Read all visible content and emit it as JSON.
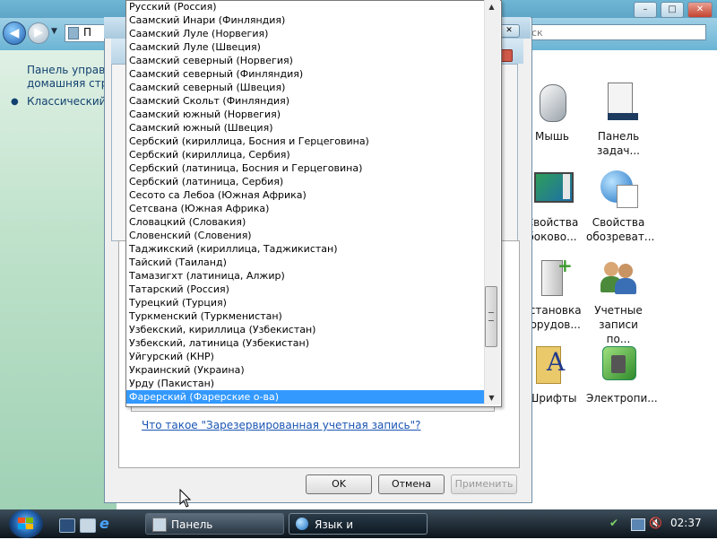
{
  "control_panel": {
    "sidebar": {
      "home_line1": "Панель управле",
      "home_line2": "домашняя стра",
      "classic_view": "Классический в"
    },
    "search_placeholder": "ск",
    "address_char": "П",
    "icons": [
      {
        "line1": "Мышь",
        "line2": ""
      },
      {
        "line1": "Панель",
        "line2": "задач..."
      },
      {
        "line1": "Свойства",
        "line2": "боково..."
      },
      {
        "line1": "Свойства",
        "line2": "обозреват..."
      },
      {
        "line1": "Установка",
        "line2": "борудов..."
      },
      {
        "line1": "Учетные",
        "line2": "записи по..."
      },
      {
        "line1": "Шрифты",
        "line2": ""
      },
      {
        "line1": "Электропи...",
        "line2": ""
      }
    ]
  },
  "dialog": {
    "link": "Что такое \"Зарезервированная учетная запись\"?",
    "buttons": {
      "ok": "OK",
      "cancel": "Отмена",
      "apply": "Применить"
    }
  },
  "language_list": {
    "items": [
      "Русский (Россия)",
      "Саамский Инари (Финляндия)",
      "Саамский Луле (Норвегия)",
      "Саамский Луле (Швеция)",
      "Саамский северный (Норвегия)",
      "Саамский северный (Финляндия)",
      "Саамский северный (Швеция)",
      "Саамский Скольт (Финляндия)",
      "Саамский южный (Норвегия)",
      "Саамский южный (Швеция)",
      "Сербский (кириллица, Босния и Герцеговина)",
      "Сербский (кириллица, Сербия)",
      "Сербский (латиница, Босния и Герцеговина)",
      "Сербский (латиница, Сербия)",
      "Сесото са Лебоа (Южная Африка)",
      "Сетсвана (Южная Африка)",
      "Словацкий (Словакия)",
      "Словенский (Словения)",
      "Таджикский (кириллица, Таджикистан)",
      "Тайский (Таиланд)",
      "Тамазигхт (латиница, Алжир)",
      "Татарский (Россия)",
      "Турецкий (Турция)",
      "Туркменский (Туркменистан)",
      "Узбекский, кириллица (Узбекистан)",
      "Узбекский, латиница (Узбекистан)",
      "Уйгурский (КНР)",
      "Украинский (Украина)",
      "Урду (Пакистан)",
      "Фарерский (Фарерские о-ва)"
    ],
    "selected": "Фарерский (Фарерские о-ва)"
  },
  "taskbar": {
    "buttons": [
      {
        "label": "Панель управления"
      },
      {
        "label": "Язык и региональн..."
      }
    ],
    "clock": "02:37"
  }
}
